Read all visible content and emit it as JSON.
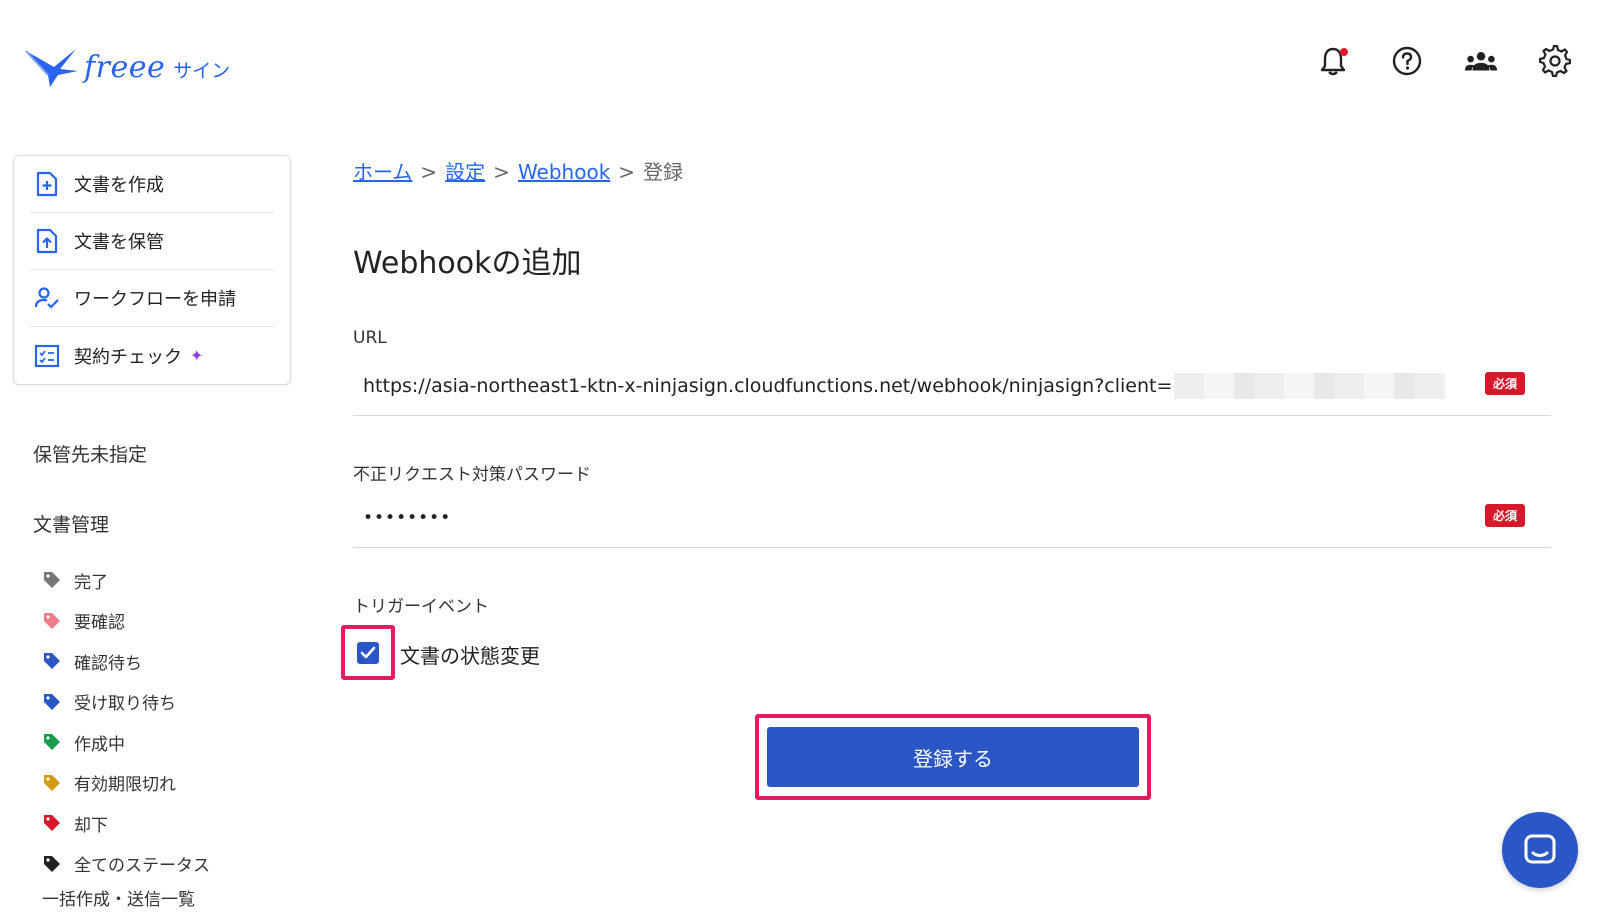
{
  "header": {
    "logo_text": "freee",
    "logo_sub": "サイン",
    "icons": [
      "bell-icon",
      "help-icon",
      "team-icon",
      "gear-icon"
    ],
    "brand_color": "#2864f0"
  },
  "sidebar": {
    "actions": [
      {
        "label": "文書を作成",
        "icon": "document-add-icon"
      },
      {
        "label": "文書を保管",
        "icon": "document-upload-icon"
      },
      {
        "label": "ワークフローを申請",
        "icon": "user-check-icon"
      },
      {
        "label": "契約チェック",
        "icon": "checklist-icon",
        "badge": "✦"
      }
    ],
    "unassigned_label": "保管先未指定",
    "doc_mgmt_title": "文書管理",
    "tags": [
      {
        "label": "完了",
        "color": "#777777"
      },
      {
        "label": "要確認",
        "color": "#ee7d8a"
      },
      {
        "label": "確認待ち",
        "color": "#2a56c6"
      },
      {
        "label": "受け取り待ち",
        "color": "#2a56c6"
      },
      {
        "label": "作成中",
        "color": "#1b9c4a"
      },
      {
        "label": "有効期限切れ",
        "color": "#d49a14"
      },
      {
        "label": "却下",
        "color": "#d7182a"
      },
      {
        "label": "全てのステータス",
        "color": "#222222"
      }
    ],
    "batch_label": "一括作成・送信一覧"
  },
  "breadcrumb": {
    "home": "ホーム",
    "settings": "設定",
    "webhook": "Webhook",
    "current": "登録",
    "sep": ">"
  },
  "main": {
    "title": "Webhookの追加",
    "url_label": "URL",
    "url_value": "https://asia-northeast1-ktn-x-ninjasign.cloudfunctions.net/webhook/ninjasign?client=",
    "required": "必須",
    "password_label": "不正リクエスト対策パスワード",
    "password_value": "••••••••",
    "trigger_label": "トリガーイベント",
    "trigger_option": "文書の状態変更",
    "trigger_checked": true,
    "submit_label": "登録する"
  }
}
